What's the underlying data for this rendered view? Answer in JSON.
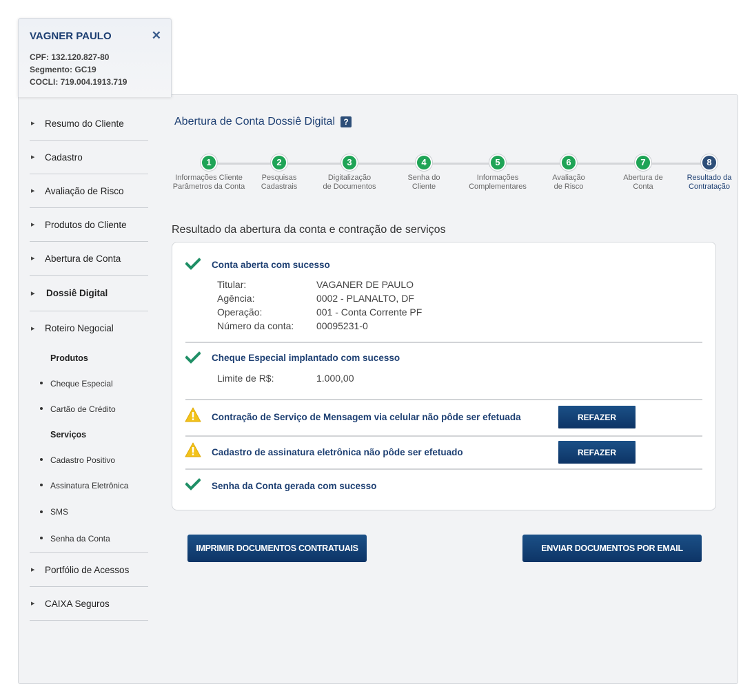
{
  "client": {
    "name": "VAGNER PAULO",
    "cpf_label": "CPF:",
    "cpf": "132.120.827-80",
    "segmento_label": "Segmento:",
    "segmento": "GC19",
    "cocli_label": "COCLI:",
    "cocli": "719.004.1913.719"
  },
  "sidebar": {
    "items": [
      {
        "label": "Resumo do Cliente"
      },
      {
        "label": "Cadastro"
      },
      {
        "label": "Avaliação de Risco"
      },
      {
        "label": "Produtos do Cliente"
      },
      {
        "label": "Abertura de Conta"
      },
      {
        "label": "Dossiê Digital"
      },
      {
        "label": "Roteiro Negocial"
      },
      {
        "label": "Portfólio de Acessos"
      },
      {
        "label": "CAIXA Seguros"
      }
    ],
    "roteiro": {
      "produtos_heading": "Produtos",
      "produtos": [
        "Cheque Especial",
        "Cartão de Crédito"
      ],
      "servicos_heading": "Serviços",
      "servicos": [
        "Cadastro Positivo",
        "Assinatura Eletrônica",
        "SMS",
        "Senha da Conta"
      ]
    }
  },
  "page": {
    "title": "Abertura de Conta Dossiê Digital",
    "help": "?"
  },
  "stepper": {
    "steps": [
      {
        "num": "1",
        "line1": "Informações Cliente",
        "line2": "Parâmetros da Conta"
      },
      {
        "num": "2",
        "line1": "Pesquisas",
        "line2": "Cadastrais"
      },
      {
        "num": "3",
        "line1": "Digitalização",
        "line2": "de Documentos"
      },
      {
        "num": "4",
        "line1": "Senha do",
        "line2": "Cliente"
      },
      {
        "num": "5",
        "line1": "Informações",
        "line2": "Complementares"
      },
      {
        "num": "6",
        "line1": "Avaliação",
        "line2": "de Risco"
      },
      {
        "num": "7",
        "line1": "Abertura de",
        "line2": "Conta"
      },
      {
        "num": "8",
        "line1": "Resultado da",
        "line2": "Contratação"
      }
    ],
    "active_step": 8
  },
  "result": {
    "section_title": "Resultado da abertura da conta e contração de serviços",
    "conta": {
      "title": "Conta aberta com sucesso",
      "titular_label": "Titular:",
      "titular": "VAGANER DE PAULO",
      "agencia_label": "Agência:",
      "agencia": "0002 - PLANALTO, DF",
      "operacao_label": "Operação:",
      "operacao": "001 - Conta Corrente PF",
      "numero_label": "Número da conta:",
      "numero": "00095231-0"
    },
    "cheque": {
      "title": "Cheque Especial implantado com sucesso",
      "limite_label": "Limite de R$:",
      "limite": "1.000,00"
    },
    "sms": {
      "title": "Contração de Serviço de Mensagem via celular não pôde ser efetuada",
      "button": "REFAZER"
    },
    "assinatura": {
      "title": "Cadastro de assinatura eletrônica não pôde ser efetuado",
      "button": "REFAZER"
    },
    "senha": {
      "title": "Senha da Conta gerada com sucesso"
    }
  },
  "actions": {
    "imprimir": "IMPRIMIR DOCUMENTOS CONTRATUAIS",
    "enviar": "ENVIAR DOCUMENTOS POR EMAIL"
  },
  "colors": {
    "primary": "#1d3f72",
    "success": "#1fa456",
    "warning": "#f0c419",
    "button": "#0d3466"
  }
}
